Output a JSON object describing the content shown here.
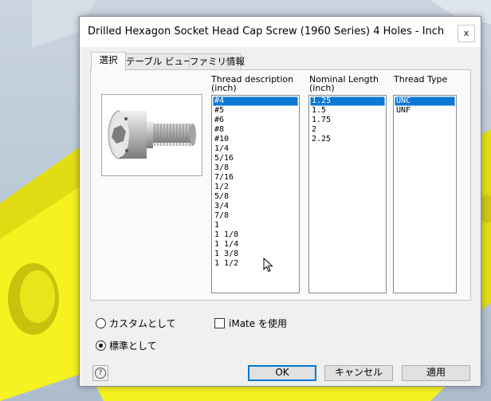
{
  "window": {
    "title": "Drilled Hexagon Socket Head Cap Screw (1960 Series) 4 Holes - Inch",
    "close_glyph": "x"
  },
  "tabs": [
    {
      "label": "選択",
      "active": true
    },
    {
      "label": "テーブル ビュー",
      "active": false
    },
    {
      "label": "ファミリ情報",
      "active": false
    }
  ],
  "columns": {
    "thread_description": {
      "header_line1": "Thread description",
      "header_line2": "(inch)",
      "items": [
        "#4",
        "#5",
        "#6",
        "#8",
        "#10",
        "1/4",
        "5/16",
        "3/8",
        "7/16",
        "1/2",
        "5/8",
        "3/4",
        "7/8",
        "1",
        "1 1/8",
        "1 1/4",
        "1 3/8",
        "1 1/2"
      ],
      "selected": "#4"
    },
    "nominal_length": {
      "header_line1": "Nominal Length",
      "header_line2": "(inch)",
      "items": [
        "1.25",
        "1.5",
        "1.75",
        "2",
        "2.25"
      ],
      "selected": "1.25"
    },
    "thread_type": {
      "header_line1": "Thread Type",
      "items": [
        "UNC",
        "UNF"
      ],
      "selected": "UNC"
    }
  },
  "options": {
    "custom_label": "カスタムとして",
    "custom_checked": false,
    "standard_label": "標準として",
    "standard_checked": true,
    "imate_label": "iMate を使用",
    "imate_checked": false
  },
  "buttons": {
    "help": "?",
    "ok": "OK",
    "cancel": "キャンセル",
    "apply": "適用"
  },
  "colors": {
    "selection": "#0f78d7",
    "default_button_border": "#0078d7",
    "background_part": "#f5f21f"
  },
  "icons": {
    "preview": "screw-preview-image",
    "help": "help-icon",
    "cursor": "mouse-pointer-icon"
  }
}
